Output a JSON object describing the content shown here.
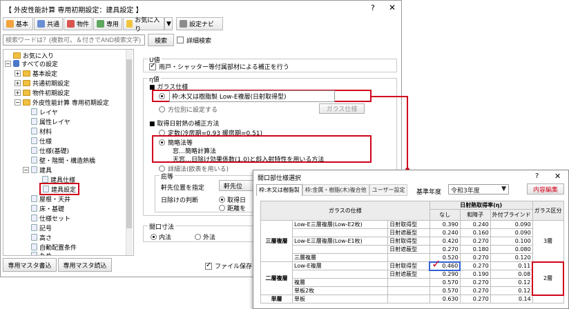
{
  "window": {
    "title": "【 外皮性能計算 専用初期設定：建具設定 】",
    "help": "?",
    "close": "✕"
  },
  "toolbar": {
    "basic": "基本",
    "common": "共通",
    "property": "物件",
    "dedicated": "専用",
    "favorites": "お気に入り",
    "nav": "設定ナビ"
  },
  "search": {
    "placeholder": "検索ワードは？(複数可。＆付きでAND検索文字)",
    "button": "検索",
    "detail": "詳細検索"
  },
  "tree": {
    "favorites": "お気に入り",
    "all": "すべての設定",
    "basic": "基本設定",
    "common": "共通初期設定",
    "property": "物件初期設定",
    "eval": "外皮性能計算 専用初期設定",
    "layer": "レイヤ",
    "attr_layer": "属性レイヤ",
    "material": "材料",
    "spec": "仕様",
    "spec_base": "仕様(基礎)",
    "wall": "壁・階間・構造熱橋",
    "fittings": "建具",
    "fit_spec": "建具仕様",
    "fit_settings": "建具設定",
    "roof": "屋根・天井",
    "floor": "床・基礎",
    "spec_set": "仕様セット",
    "symbol": "記号",
    "height": "高さ",
    "auto": "自動配置条件",
    "round": "丸め"
  },
  "bottom": {
    "write": "専用マスタ書込",
    "read": "専用マスタ読込",
    "save": "ファイル保存"
  },
  "u_value": {
    "label": "U値",
    "check": "雨戸・シャッター等付属部材による補正を行う"
  },
  "eta": {
    "label": "η値",
    "glass_group": "ガラス仕様",
    "glass_value": "枠:木又は樹脂製 Low-E複層(日射取得型)",
    "glass_each": "方位別に設定する",
    "glass_btn": "ガラス仕様",
    "correction_group": "取得日射熱の補正方法",
    "opt_fixed": "定数(冷房期=0.93 暖房期=0.51)",
    "opt_simple": "簡略法等",
    "simple_line1": "窓…簡略計算法",
    "simple_line2": "天窓…日除け効果係数(1.0)と斜入射特性を用いる方法",
    "opt_detail": "詳細法(欧表を用いる)",
    "eaves_group": "庇等",
    "eaves_pos": "軒先位置を指定",
    "eaves_pos2": "軒先位",
    "shade_judge": "日除けの判断",
    "shade_opt1": "取得日",
    "shade_opt2": "距離を"
  },
  "opening": {
    "label": "開口寸法",
    "inner": "内法",
    "outer": "外法"
  },
  "dialog": {
    "title": "開口部仕様選択",
    "help": "?",
    "close": "✕",
    "tab1": "枠:木又は樹脂製",
    "tab2": "枠:金属・樹脂(木)複合他",
    "tab3": "ユーザー設定",
    "year_label": "基準年度",
    "year": "令和3年度",
    "edit": "内容編集",
    "col_glass": "ガラスの仕様",
    "col_eta": "日射熱取得率(η)",
    "col_none": "なし",
    "col_shoji": "和障子",
    "col_blind": "外付ブラインド",
    "col_class": "ガラス区分",
    "g_triple": "三層複層",
    "g_double": "二層複層",
    "g_single": "単層",
    "rows": [
      {
        "spec": "Low-E三層複層(Low-E2枚)",
        "type": "日射取得型",
        "none": "0.390",
        "shoji": "0.240",
        "blind": "0.090"
      },
      {
        "spec": "",
        "type": "日射遮蔽型",
        "none": "0.240",
        "shoji": "0.160",
        "blind": "0.090"
      },
      {
        "spec": "Low-E三層複層(Low-E1枚)",
        "type": "日射取得型",
        "none": "0.420",
        "shoji": "0.270",
        "blind": "0.100"
      },
      {
        "spec": "",
        "type": "日射遮蔽型",
        "none": "0.270",
        "shoji": "0.180",
        "blind": "0.080"
      },
      {
        "spec": "三層複層",
        "type": "",
        "none": "0.520",
        "shoji": "0.270",
        "blind": "0.120"
      },
      {
        "spec": "Low-E複層",
        "type": "日射取得型",
        "none": "0.460",
        "shoji": "0.270",
        "blind": "0.11"
      },
      {
        "spec": "",
        "type": "日射遮蔽型",
        "none": "0.290",
        "shoji": "0.190",
        "blind": "0.08"
      },
      {
        "spec": "複層",
        "type": "",
        "none": "0.570",
        "shoji": "0.270",
        "blind": "0.12"
      },
      {
        "spec": "単板2枚",
        "type": "",
        "none": "0.570",
        "shoji": "0.270",
        "blind": "0.12"
      },
      {
        "spec": "単板",
        "type": "",
        "none": "0.630",
        "shoji": "0.270",
        "blind": "0.14"
      }
    ],
    "class_triple": "3層",
    "class_double": "2層"
  }
}
